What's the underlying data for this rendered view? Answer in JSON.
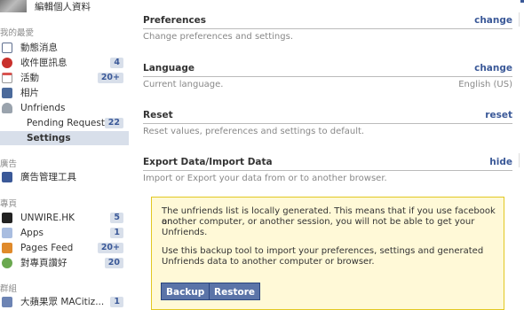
{
  "sidebar": {
    "profile_label": "編輯個人資料",
    "favorites_header": "我的最愛",
    "items": [
      {
        "label": "動態消息",
        "count": "",
        "icon": "news-feed-icon",
        "color": "#6d84b4"
      },
      {
        "label": "收件匣訊息",
        "count": "4",
        "icon": "messages-icon",
        "color": "#c9302c"
      },
      {
        "label": "活動",
        "count": "20+",
        "icon": "events-icon",
        "color": "#d9534f"
      },
      {
        "label": "相片",
        "count": "",
        "icon": "photos-icon",
        "color": "#4b6a9b"
      },
      {
        "label": "Unfriends",
        "count": "",
        "icon": "unfriends-icon",
        "color": "#7f8c8d"
      }
    ],
    "unfriends_sub": [
      {
        "label": "Pending Requests",
        "count": "22"
      },
      {
        "label": "Settings",
        "count": ""
      }
    ],
    "ads_header": "廣告",
    "ads_items": [
      {
        "label": "廣告管理工具",
        "icon": "ads-manager-icon",
        "color": "#3b5998"
      }
    ],
    "pages_header": "專頁",
    "pages_items": [
      {
        "label": "UNWIRE.HK",
        "count": "5",
        "icon": "unwire-icon",
        "color": "#222"
      },
      {
        "label": "Apps",
        "count": "1",
        "icon": "apps-icon",
        "color": "#8aa4d6"
      },
      {
        "label": "Pages Feed",
        "count": "20+",
        "icon": "pages-feed-icon",
        "color": "#e08a2b"
      },
      {
        "label": "對專頁讚好",
        "count": "20",
        "icon": "like-pages-icon",
        "color": "#6aa84f"
      }
    ],
    "groups_header": "群組",
    "groups_items": [
      {
        "label": "大蘋果眾 MACitiz...",
        "count": "1",
        "icon": "group-icon",
        "color": "#6d84b4"
      }
    ]
  },
  "main": {
    "sections": [
      {
        "title": "Preferences",
        "action": "change",
        "desc": "Change preferences and settings.",
        "value": ""
      },
      {
        "title": "Language",
        "action": "change",
        "desc": "Current language.",
        "value": "English (US)"
      },
      {
        "title": "Reset",
        "action": "reset",
        "desc": "Reset values, preferences and settings to default.",
        "value": ""
      },
      {
        "title": "Export Data/Import Data",
        "action": "hide",
        "desc": "Import or Export your data from or to another browser.",
        "value": ""
      }
    ],
    "notice": {
      "line1": "The unfriends list is locally generated. This means that if you use facebook on",
      "line2": "another computer, or another session, you will not be able to get your",
      "line3": "Unfriends.",
      "line4": "Use this backup tool to import your preferences, settings and generated",
      "line5": "Unfriends data to another computer or browser.",
      "backup_label": "Backup",
      "restore_label": "Restore"
    }
  }
}
